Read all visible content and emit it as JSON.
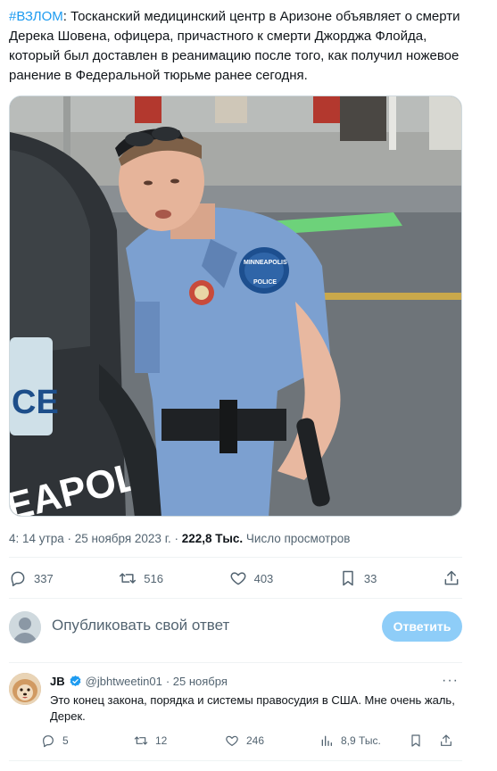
{
  "tweet": {
    "hashtag": "#ВЗЛОМ",
    "text": ": Тосканский медицинский центр в Аризоне объявляет о смерти Дерека Шовена, офицера, причастного к смерти Джорджа Флойда, который был доставлен в реанимацию после того, как получил ножевое ранение в Федеральной тюрьме ранее сегодня.",
    "media_description_icon": "police-officer-photo",
    "timestamp": "4: 14 утра · 25 ноября 2023 г.",
    "views_count": "222,8 Тыс.",
    "views_label": "Число просмотров",
    "actions": {
      "replies": "337",
      "retweets": "516",
      "likes": "403",
      "bookmarks": "33"
    },
    "patch_texts": {
      "shoulder_patch": "MINNEAPOLIS POLICE",
      "plate": "CE",
      "car_text": "EAPOLIS"
    }
  },
  "reply_composer": {
    "placeholder": "Опубликовать свой ответ",
    "button": "Ответить"
  },
  "reply": {
    "name": "JB",
    "handle": "@jbhtweetin01",
    "date": "· 25 ноября",
    "text": "Это конец закона, порядка и системы правосудия в США. Мне очень жаль, Дерек.",
    "more": "···",
    "actions": {
      "replies": "5",
      "retweets": "12",
      "likes": "246",
      "views": "8,9 Тыс."
    }
  },
  "colors": {
    "accent": "#1d9bf0",
    "reply_button": "#8ecdf8",
    "secondary_text": "#536471"
  }
}
